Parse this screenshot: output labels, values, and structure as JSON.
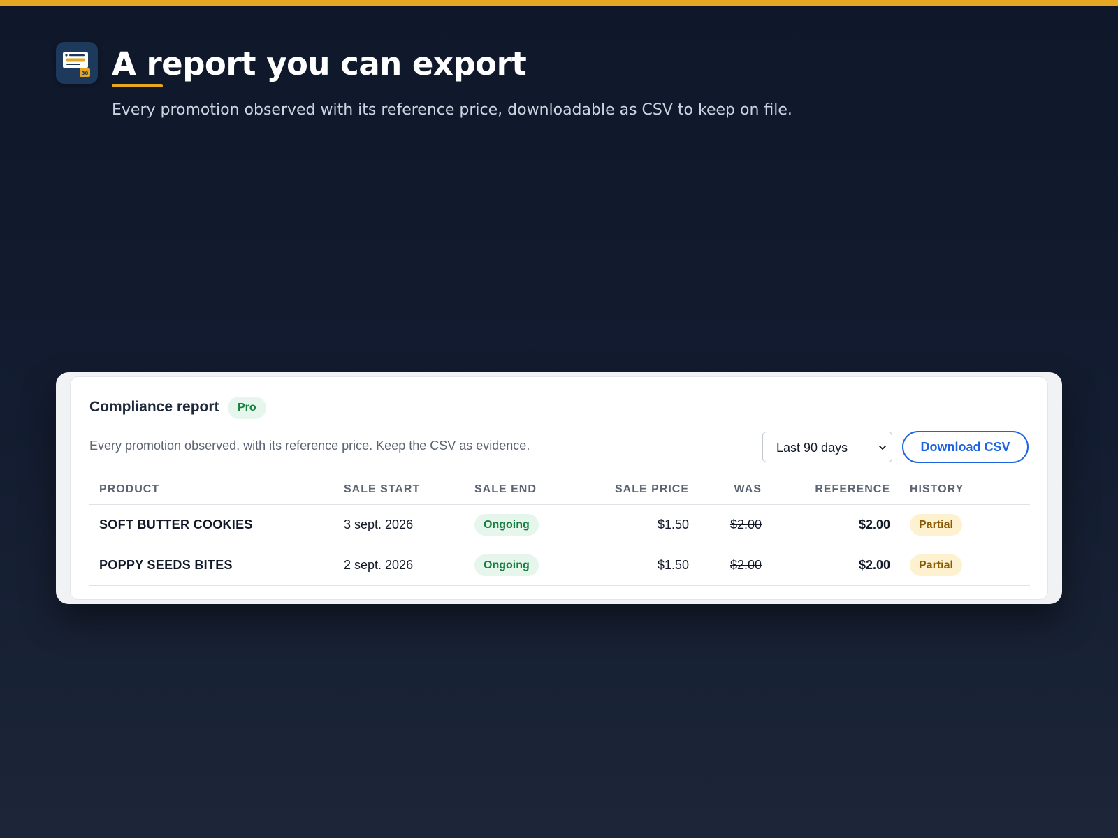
{
  "hero": {
    "title": "A report you can export",
    "subtitle": "Every promotion observed with its reference price, downloadable as CSV to keep on file.",
    "app_icon": "receipt-calendar-icon",
    "app_icon_badge": "30"
  },
  "colors": {
    "accent": "#e5a823",
    "background": "#0f172a",
    "link_blue": "#1d64e0",
    "success_green": "#15803d",
    "warning_amber": "#8a5a00"
  },
  "report": {
    "title": "Compliance report",
    "badge": "Pro",
    "description": "Every promotion observed, with its reference price. Keep the CSV as evidence.",
    "range_select": {
      "value": "Last 90 days",
      "icon": "chevron-down-icon"
    },
    "download_label": "Download CSV",
    "columns": {
      "product": "PRODUCT",
      "sale_start": "SALE START",
      "sale_end": "SALE END",
      "sale_price": "SALE PRICE",
      "was": "WAS",
      "reference": "REFERENCE",
      "history": "HISTORY"
    },
    "rows": [
      {
        "product": "SOFT BUTTER COOKIES",
        "sale_start": "3 sept. 2026",
        "sale_end": "Ongoing",
        "sale_price": "$1.50",
        "was": "$2.00",
        "reference": "$2.00",
        "history": "Partial"
      },
      {
        "product": "POPPY SEEDS BITES",
        "sale_start": "2 sept. 2026",
        "sale_end": "Ongoing",
        "sale_price": "$1.50",
        "was": "$2.00",
        "reference": "$2.00",
        "history": "Partial"
      }
    ]
  }
}
